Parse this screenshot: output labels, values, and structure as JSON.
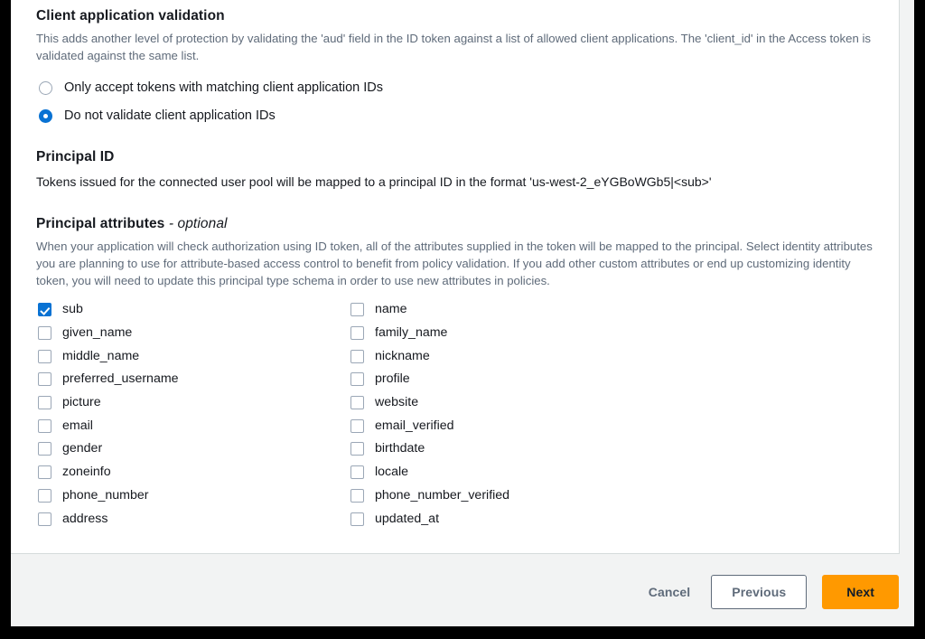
{
  "client_validation": {
    "title": "Client application validation",
    "description": "This adds another level of protection by validating the 'aud' field in the ID token against a list of allowed client applications. The 'client_id' in the Access token is validated against the same list.",
    "options": [
      {
        "label": "Only accept tokens with matching client application IDs",
        "selected": false
      },
      {
        "label": "Do not validate client application IDs",
        "selected": true
      }
    ]
  },
  "principal_id": {
    "title": "Principal ID",
    "text": "Tokens issued for the connected user pool will be mapped to a principal ID in the format 'us-west-2_eYGBoWGb5|<sub>'"
  },
  "principal_attributes": {
    "title": "Principal attributes",
    "title_optional": "- optional",
    "description": "When your application will check authorization using ID token, all of the attributes supplied in the token will be mapped to the principal. Select identity attributes you are planning to use for attribute-based access control to benefit from policy validation. If you add other custom attributes or end up customizing identity token, you will need to update this principal type schema in order to use new attributes in policies.",
    "left_column": [
      {
        "label": "sub",
        "checked": true
      },
      {
        "label": "given_name",
        "checked": false
      },
      {
        "label": "middle_name",
        "checked": false
      },
      {
        "label": "preferred_username",
        "checked": false
      },
      {
        "label": "picture",
        "checked": false
      },
      {
        "label": "email",
        "checked": false
      },
      {
        "label": "gender",
        "checked": false
      },
      {
        "label": "zoneinfo",
        "checked": false
      },
      {
        "label": "phone_number",
        "checked": false
      },
      {
        "label": "address",
        "checked": false
      }
    ],
    "right_column": [
      {
        "label": "name",
        "checked": false
      },
      {
        "label": "family_name",
        "checked": false
      },
      {
        "label": "nickname",
        "checked": false
      },
      {
        "label": "profile",
        "checked": false
      },
      {
        "label": "website",
        "checked": false
      },
      {
        "label": "email_verified",
        "checked": false
      },
      {
        "label": "birthdate",
        "checked": false
      },
      {
        "label": "locale",
        "checked": false
      },
      {
        "label": "phone_number_verified",
        "checked": false
      },
      {
        "label": "updated_at",
        "checked": false
      }
    ]
  },
  "footer": {
    "cancel_label": "Cancel",
    "previous_label": "Previous",
    "next_label": "Next"
  },
  "colors": {
    "accent_blue": "#0972d3",
    "primary_orange": "#ff9900",
    "text_dark": "#16191f",
    "text_muted": "#5f6b7a",
    "page_background": "#f2f3f3",
    "card_background": "#ffffff"
  }
}
